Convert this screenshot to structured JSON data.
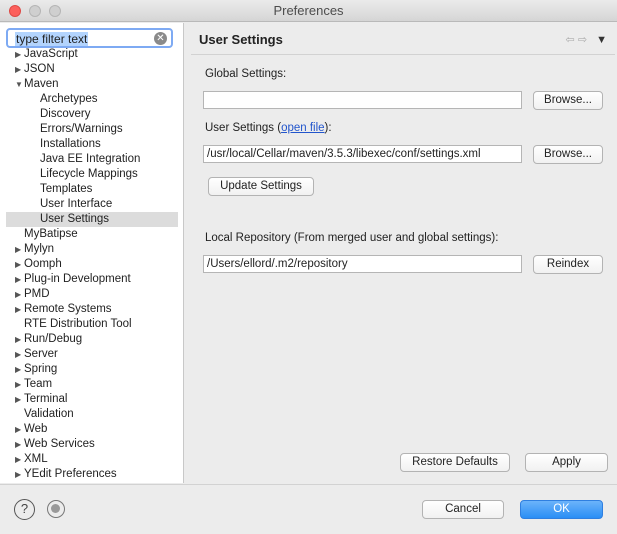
{
  "window": {
    "title": "Preferences"
  },
  "filter": {
    "placeholder": "type filter text"
  },
  "tree": [
    {
      "label": "JavaScript",
      "arrow": "▶",
      "child": false
    },
    {
      "label": "JSON",
      "arrow": "▶",
      "child": false
    },
    {
      "label": "Maven",
      "arrow": "▼",
      "child": false
    },
    {
      "label": "Archetypes",
      "arrow": "",
      "child": true
    },
    {
      "label": "Discovery",
      "arrow": "",
      "child": true
    },
    {
      "label": "Errors/Warnings",
      "arrow": "",
      "child": true
    },
    {
      "label": "Installations",
      "arrow": "",
      "child": true
    },
    {
      "label": "Java EE Integration",
      "arrow": "",
      "child": true
    },
    {
      "label": "Lifecycle Mappings",
      "arrow": "",
      "child": true
    },
    {
      "label": "Templates",
      "arrow": "",
      "child": true
    },
    {
      "label": "User Interface",
      "arrow": "",
      "child": true
    },
    {
      "label": "User Settings",
      "arrow": "",
      "child": true,
      "selected": true
    },
    {
      "label": "MyBatipse",
      "arrow": "",
      "child": false
    },
    {
      "label": "Mylyn",
      "arrow": "▶",
      "child": false
    },
    {
      "label": "Oomph",
      "arrow": "▶",
      "child": false
    },
    {
      "label": "Plug-in Development",
      "arrow": "▶",
      "child": false
    },
    {
      "label": "PMD",
      "arrow": "▶",
      "child": false
    },
    {
      "label": "Remote Systems",
      "arrow": "▶",
      "child": false
    },
    {
      "label": "RTE Distribution Tool",
      "arrow": "",
      "child": false
    },
    {
      "label": "Run/Debug",
      "arrow": "▶",
      "child": false
    },
    {
      "label": "Server",
      "arrow": "▶",
      "child": false
    },
    {
      "label": "Spring",
      "arrow": "▶",
      "child": false
    },
    {
      "label": "Team",
      "arrow": "▶",
      "child": false
    },
    {
      "label": "Terminal",
      "arrow": "▶",
      "child": false
    },
    {
      "label": "Validation",
      "arrow": "",
      "child": false
    },
    {
      "label": "Web",
      "arrow": "▶",
      "child": false
    },
    {
      "label": "Web Services",
      "arrow": "▶",
      "child": false
    },
    {
      "label": "XML",
      "arrow": "▶",
      "child": false
    },
    {
      "label": "YEdit Preferences",
      "arrow": "▶",
      "child": false
    }
  ],
  "page": {
    "title": "User Settings",
    "nav_back": "⇦",
    "nav_forward": "⇨",
    "nav_menu": "▼",
    "global_settings_label": "Global Settings:",
    "global_settings_value": "",
    "browse_label": "Browse...",
    "user_settings_label": "User Settings (",
    "open_file_link": "open file",
    "user_settings_label_end": "):",
    "user_settings_value": "/usr/local/Cellar/maven/3.5.3/libexec/conf/settings.xml",
    "update_settings_label": "Update Settings",
    "local_repo_label": "Local Repository (From merged user and global settings):",
    "local_repo_value": "/Users/ellord/.m2/repository",
    "reindex_label": "Reindex",
    "restore_defaults_label": "Restore Defaults",
    "apply_label": "Apply"
  },
  "footer": {
    "help_glyph": "?",
    "cancel_label": "Cancel",
    "ok_label": "OK"
  }
}
